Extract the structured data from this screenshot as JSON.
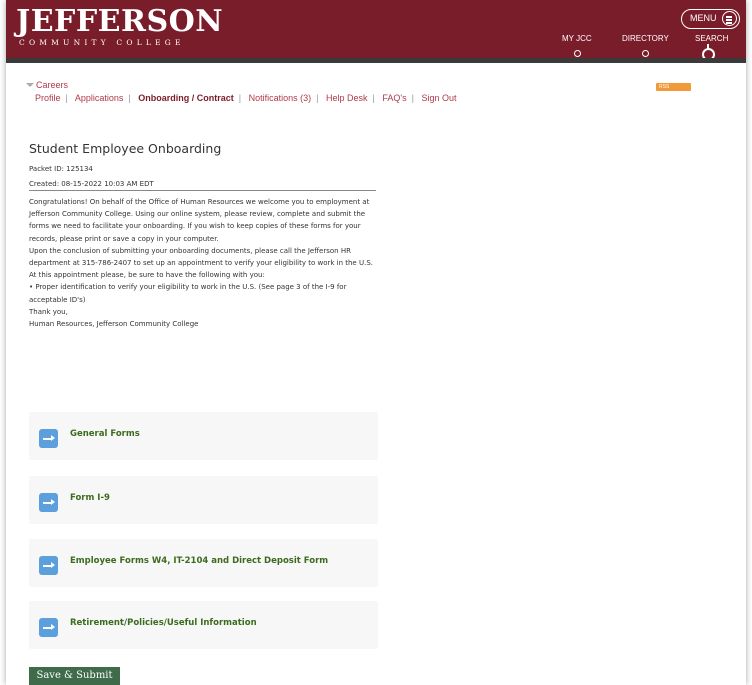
{
  "header": {
    "logo_main": "JEFFERSON",
    "logo_sub": "COMMUNITY COLLEGE",
    "menu_label": "MENU",
    "nav": [
      "MY JCC",
      "DIRECTORY",
      "SEARCH"
    ],
    "brand_color": "#7a1d2b"
  },
  "breadcrumb": {
    "label": "Careers"
  },
  "subnav": {
    "items": [
      "Profile",
      "Applications",
      "Onboarding / Contract",
      "Notifications (3)",
      "Help Desk",
      "FAQ's",
      "Sign Out"
    ],
    "active": "Onboarding / Contract"
  },
  "rss_label": "RSS",
  "main": {
    "title": "Student Employee Onboarding",
    "packet_id": "Packet ID: 125134",
    "created": "Created: 08-15-2022 10:03 AM EDT",
    "paragraphs": [
      "Congratulations!  On behalf of the Office of Human Resources we welcome you to employment at Jefferson Community College.  Using our online system, please review, complete and submit the forms we need to facilitate your onboarding.  If you wish to keep copies of these forms for your records, please print or save a copy in your computer.",
      "Upon the conclusion of submitting your onboarding documents, please call the Jefferson HR department at 315-786-2407 to set up an appointment to verify your eligibility to work in the U.S.",
      "At this appointment please, be sure to have the following with you:",
      "•  Proper identification to verify your eligibility to work in the U.S. (See page 3 of the I-9 for acceptable ID's)",
      "Thank you,",
      "Human Resources, Jefferson Community College"
    ],
    "sections": [
      "General Forms",
      "Form I-9",
      "Employee Forms W4, IT-2104 and Direct Deposit Form",
      "Retirement/Policies/Useful Information"
    ],
    "submit_label": "Save & Submit"
  }
}
